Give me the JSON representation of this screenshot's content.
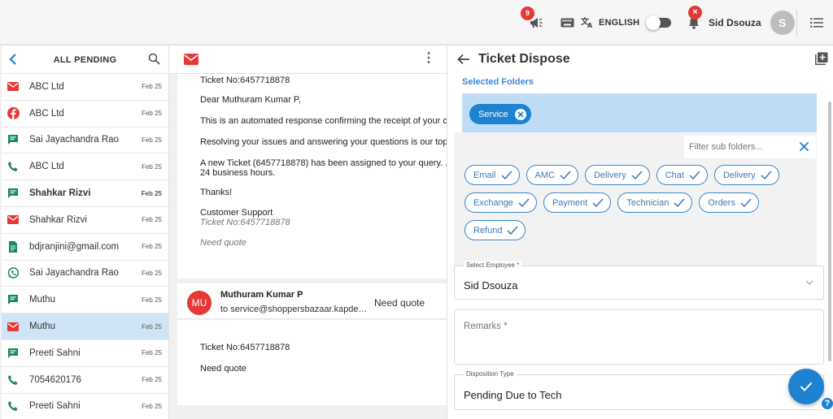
{
  "topbar": {
    "announce_badge": "9",
    "notify_badge": "×",
    "language": "ENGLISH",
    "user_name": "Sid Dsouza",
    "avatar_initial": "S"
  },
  "left": {
    "title": "ALL PENDING",
    "conversations": [
      {
        "name": "ABC Ltd",
        "date": "Feb 25",
        "channel": "email",
        "bold": false
      },
      {
        "name": "ABC Ltd",
        "date": "Feb 25",
        "channel": "facebook",
        "bold": false
      },
      {
        "name": "Sai Jayachandra Rao",
        "date": "Feb 25",
        "channel": "chat",
        "bold": false
      },
      {
        "name": "ABC Ltd",
        "date": "Feb 25",
        "channel": "phone",
        "bold": false
      },
      {
        "name": "Shahkar Rizvi",
        "date": "Feb 25",
        "channel": "chat",
        "bold": true
      },
      {
        "name": "Shahkar Rizvi",
        "date": "Feb 25",
        "channel": "email",
        "bold": false
      },
      {
        "name": "bdjranjini@gmail.com",
        "date": "Feb 25",
        "channel": "form",
        "bold": false
      },
      {
        "name": "Sai Jayachandra Rao",
        "date": "Feb 25",
        "channel": "whatsapp",
        "bold": false
      },
      {
        "name": "Muthu",
        "date": "Feb 25",
        "channel": "chat",
        "bold": false
      },
      {
        "name": "Muthu",
        "date": "Feb 25",
        "channel": "email",
        "bold": false
      },
      {
        "name": "Preeti Sahni",
        "date": "Feb 25",
        "channel": "chat",
        "bold": false
      },
      {
        "name": "7054620176",
        "date": "Feb 25",
        "channel": "phone",
        "bold": false
      },
      {
        "name": "Preeti Sahni",
        "date": "Feb 25",
        "channel": "phone",
        "bold": false
      }
    ]
  },
  "mail": {
    "ticket_no": "Ticket No:6457718878",
    "greeting": "Dear Muthuram Kumar P,",
    "line1": "This is an automated response confirming the receipt of your c",
    "line2": "Resolving your issues and answering your questions is our top",
    "line3a": "A new Ticket (6457718878) has been assigned to your query. .",
    "line3b": "24 business hours.",
    "thanks": "Thanks!",
    "signature": "Customer Support",
    "sig_ticket": "Ticket No:6457718878",
    "need_quote": "Need quote",
    "reply_avatar": "MU",
    "reply_from": "Muthuram Kumar P",
    "reply_to": "to service@shoppersbazaar.kapdesk.com",
    "reply_subject": "Need quote",
    "reply_ticket": "Ticket No:6457718878",
    "reply_body": "Need quote"
  },
  "dispose": {
    "title": "Ticket Dispose",
    "selected_label": "Selected Folders",
    "selected_chip": "Service",
    "filter_placeholder": "Filter sub folders...",
    "sub_folders": [
      "Email",
      "AMC",
      "Delivery",
      "Chat",
      "Delivery",
      "Exchange",
      "Payment",
      "Technician",
      "Orders",
      "Refund"
    ],
    "employee_label": "Select Employee *",
    "employee_value": "Sid Dsouza",
    "remarks_placeholder": "Remarks *",
    "disposition_label": "Disposition Type",
    "disposition_value": "Pending Due to Tech"
  },
  "colors": {
    "accent": "#1e82d0",
    "selected_bg": "#bfdcf6",
    "active_row": "#cfe4f7",
    "badge": "#e53935"
  }
}
